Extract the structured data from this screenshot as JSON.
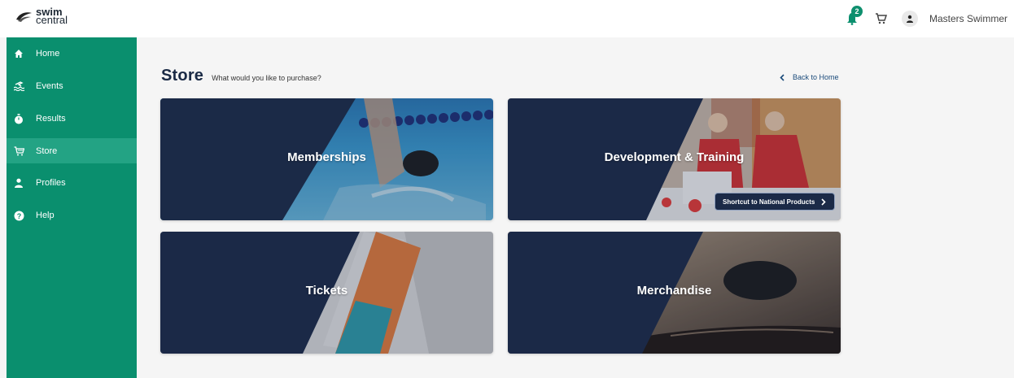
{
  "header": {
    "logo_line1": "swim",
    "logo_line2": "central",
    "notification_count": "2",
    "user_name": "Masters Swimmer"
  },
  "sidebar": {
    "items": [
      {
        "label": "Home",
        "icon": "home-icon"
      },
      {
        "label": "Events",
        "icon": "swim-icon"
      },
      {
        "label": "Results",
        "icon": "stopwatch-icon"
      },
      {
        "label": "Store",
        "icon": "cart-icon",
        "active": true
      },
      {
        "label": "Profiles",
        "icon": "person-icon"
      },
      {
        "label": "Help",
        "icon": "help-icon"
      }
    ]
  },
  "main": {
    "title": "Store",
    "subtitle": "What would you like to purchase?",
    "back_label": "Back to Home",
    "cards": [
      {
        "label": "Memberships"
      },
      {
        "label": "Development & Training",
        "shortcut_label": "Shortcut to National Products"
      },
      {
        "label": "Tickets"
      },
      {
        "label": "Merchandise"
      }
    ]
  },
  "colors": {
    "sidebar": "#0a8f6e",
    "sidebar_active": "#23a384",
    "navy_overlay": "#1b2a47",
    "badge": "#0e8f6e"
  }
}
